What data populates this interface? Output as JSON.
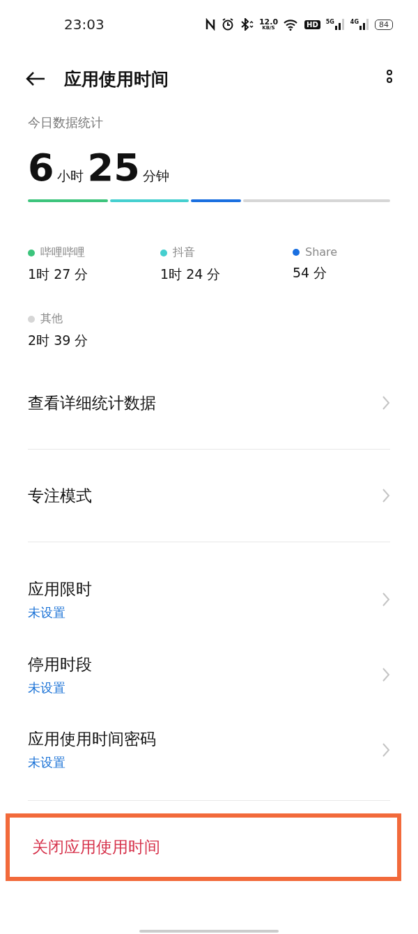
{
  "status_bar": {
    "time": "23:03",
    "speed_value": "12.0",
    "speed_unit": "KB/S",
    "hd": "HD",
    "net1": "5G",
    "net2": "4G",
    "battery": "84"
  },
  "header": {
    "title": "应用使用时间"
  },
  "today": {
    "label": "今日数据统计",
    "hours": "6",
    "hours_unit": "小时",
    "minutes": "25",
    "minutes_unit": "分钟",
    "apps": [
      {
        "name": "哔哩哔哩",
        "time": "1时 27 分",
        "color": "#3cc47c"
      },
      {
        "name": "抖音",
        "time": "1时 24 分",
        "color": "#45cfcf"
      },
      {
        "name": "Share",
        "time": "54 分",
        "color": "#1a6fe0"
      },
      {
        "name": "其他",
        "time": "2时 39 分",
        "color": "#d6d6d6"
      }
    ]
  },
  "menu": [
    {
      "kind": "plain",
      "title": "查看详细统计数据"
    },
    {
      "kind": "plain",
      "title": "专注模式"
    },
    {
      "kind": "sub",
      "title": "应用限时",
      "subtitle": "未设置"
    },
    {
      "kind": "sub",
      "title": "停用时段",
      "subtitle": "未设置"
    },
    {
      "kind": "sub",
      "title": "应用使用时间密码",
      "subtitle": "未设置"
    }
  ],
  "turn_off": {
    "label": "关闭应用使用时间",
    "highlighted": true
  }
}
